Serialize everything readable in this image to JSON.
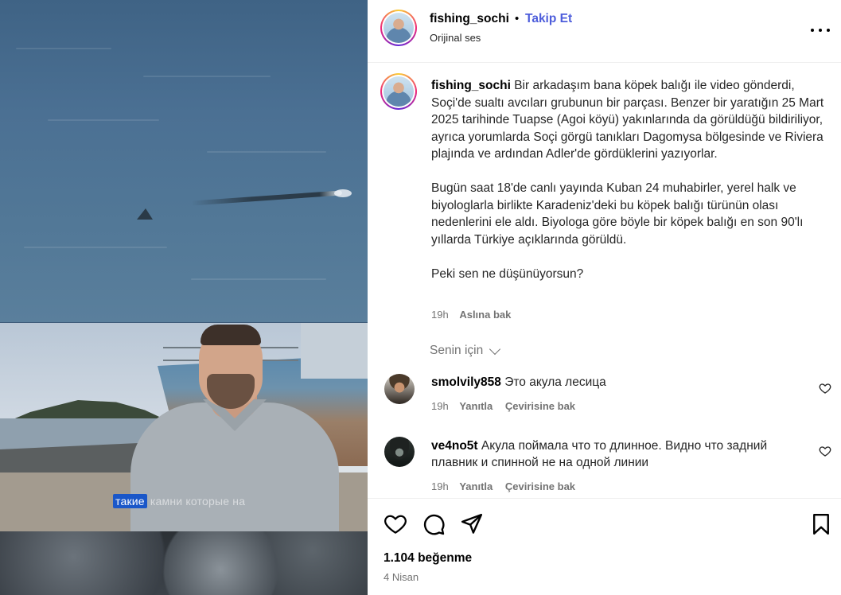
{
  "post": {
    "username": "fishing_sochi",
    "separator": "•",
    "follow_label": "Takip Et",
    "audio_label": "Orijinal ses",
    "more_label": "...",
    "video_caption_highlight": "такие",
    "video_caption_rest": "камни которые на"
  },
  "caption": {
    "username": "fishing_sochi",
    "paragraph_1": "Bir arkadaşım bana köpek balığı ile video gönderdi, Soçi'de sualtı avcıları grubunun bir parçası. Benzer bir yaratığın 25 Mart 2025 tarihinde Tuapse (Agoi köyü) yakınlarında da görüldüğü bildiriliyor, ayrıca yorumlarda Soçi görgü tanıkları Dagomysa bölgesinde ve Riviera plajında ve ardından Adler'de gördüklerini yazıyorlar.",
    "paragraph_2": "Bugün saat 18'de canlı yayında Kuban 24 muhabirler, yerel halk ve biyologlarla birlikte Karadeniz'deki bu köpek balığı türünün olası nedenlerini ele aldı. Biyologa göre böyle bir köpek balığı en son 90'lı yıllarda Türkiye açıklarında görüldü.",
    "paragraph_3": "Peki sen ne düşünüyorsun?",
    "time": "19h",
    "translate_label": "Aslına bak"
  },
  "sort": {
    "label": "Senin için"
  },
  "comments": [
    {
      "username": "smolvily858",
      "text": "Это акула лесица",
      "time": "19h",
      "reply_label": "Yanıtla",
      "translate_label": "Çevirisine bak"
    },
    {
      "username": "ve4no5t",
      "text": "Акула поймала что то длинное. Видно что задний плавник и спинной не на одной линии",
      "time": "19h",
      "reply_label": "Yanıtla",
      "translate_label": "Çevirisine bak"
    }
  ],
  "footer": {
    "likes": "1.104 beğenme",
    "date": "4 Nisan"
  },
  "colors": {
    "follow_accent": "#4d5ddb",
    "secondary_text": "#737373",
    "caption_highlight": "#1a57c9"
  }
}
